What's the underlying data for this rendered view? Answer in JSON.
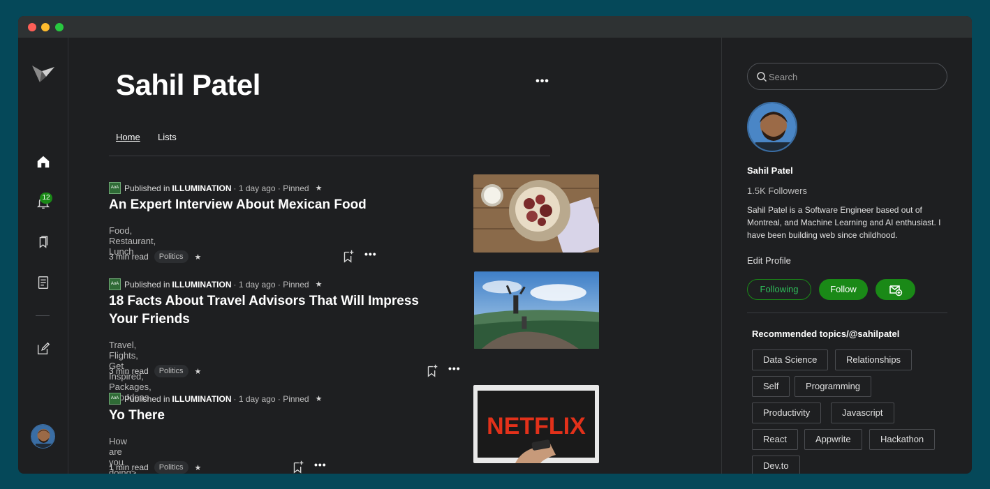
{
  "profile": {
    "name": "Sahil Patel",
    "tabs": {
      "home": "Home",
      "lists": "Lists"
    },
    "more": "•••"
  },
  "sidebar": {
    "notification_count": "12"
  },
  "articles": [
    {
      "pub_logo": "AoA",
      "published_in": "Published in",
      "publication": "ILLUMINATION",
      "meta": "· 1 day ago · Pinned",
      "title": "An Expert Interview About Mexican Food",
      "tags": "Food, Restaurant, Lunch",
      "read_time": "3 min read",
      "topic": "Politics",
      "star": "★",
      "more": "•••"
    },
    {
      "pub_logo": "AoA",
      "published_in": "Published in",
      "publication": "ILLUMINATION",
      "meta": "· 1 day ago · Pinned",
      "title": "18 Facts About Travel Advisors That Will Impress Your Friends",
      "tags": "Travel, Flights, Get Inspired, Packages, Trip Ideas",
      "read_time": "3 min read",
      "topic": "Politics",
      "star": "★",
      "more": "•••"
    },
    {
      "pub_logo": "AoA",
      "published_in": "Published in",
      "publication": "ILLUMINATION",
      "meta": "· 1 day ago · Pinned",
      "title": "Yo There",
      "tags": "How are you doing>",
      "read_time": "1 min read",
      "topic": "Politics",
      "star": "★",
      "more": "•••",
      "thumb_text": "NETFLIX"
    }
  ],
  "right_panel": {
    "search_placeholder": "Search",
    "name": "Sahil Patel",
    "followers": "1.5K Followers",
    "bio": "Sahil Patel is a Software Engineer based out of Montreal, and Machine Learning and AI enthusiast. I have been building web since childhood.",
    "edit_profile": "Edit Profile",
    "following_label": "Following",
    "follow_label": "Follow",
    "recommended_heading": "Recommended topics/@sahilpatel",
    "topics": [
      "Data Science",
      "Relationships",
      "Self",
      "Programming",
      "Productivity",
      "Javascript",
      "React",
      "Appwrite",
      "Hackathon",
      "Dev.to"
    ]
  },
  "colors": {
    "accent": "#1a8917",
    "background": "#1e1f21",
    "desktop": "#054859"
  }
}
